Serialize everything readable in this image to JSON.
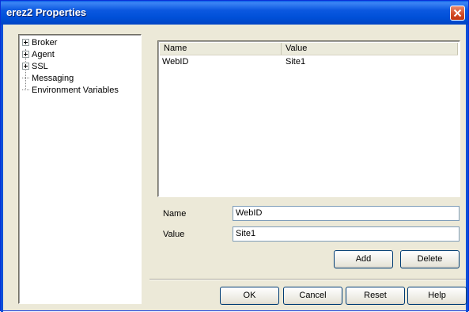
{
  "window": {
    "title": "erez2 Properties"
  },
  "tree": {
    "items": [
      {
        "label": "Broker",
        "expandable": true
      },
      {
        "label": "Agent",
        "expandable": true
      },
      {
        "label": "SSL",
        "expandable": true
      },
      {
        "label": "Messaging",
        "expandable": false
      },
      {
        "label": "Environment Variables",
        "expandable": false
      }
    ]
  },
  "list": {
    "columns": [
      "Name",
      "Value"
    ],
    "rows": [
      {
        "name": "WebID",
        "value": "Site1"
      }
    ]
  },
  "form": {
    "name_label": "Name",
    "name_value": "WebID",
    "value_label": "Value",
    "value_value": "Site1"
  },
  "buttons": {
    "add": "Add",
    "delete": "Delete",
    "ok": "OK",
    "cancel": "Cancel",
    "reset": "Reset",
    "help": "Help"
  },
  "colors": {
    "titlebar": "#0054e3",
    "close": "#d24a24",
    "face": "#ece9d8"
  }
}
